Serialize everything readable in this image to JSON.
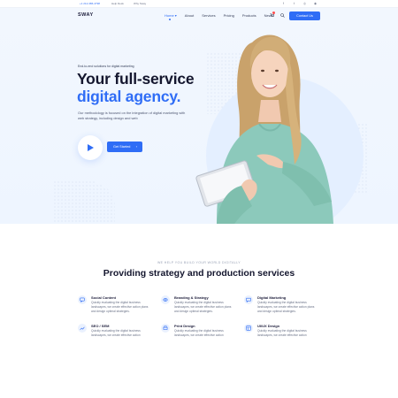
{
  "topbar": {
    "phone": "+1 212-386-4798",
    "help": "Help Desk",
    "why": "Why Sway",
    "socials": [
      "facebook-icon",
      "twitter-icon",
      "instagram-icon",
      "dribbble-icon"
    ]
  },
  "header": {
    "logo": "SWAY",
    "nav": [
      "Home",
      "About",
      "Services",
      "Pricing",
      "Products",
      "News"
    ],
    "contact_label": "Contact Us"
  },
  "hero": {
    "tagline": "End-to-end solutions for digital marketing",
    "headline_line1": "Your full-service",
    "headline_line2": "digital agency.",
    "description": "Our methodology is focused on the integration of digital marketing with web strategy, including design and web",
    "cta_label": "Get Started",
    "cta_arrow": "›"
  },
  "services": {
    "eyebrow": "WE HELP YOU BUILD YOUR WORLD DIGITALLY",
    "title": "Providing strategy and production services",
    "items": [
      {
        "title": "Social Content",
        "desc": "Quickly evaluating the digital business landscapes, we create effective action plans and design optimal strategies.",
        "icon": "chat-icon"
      },
      {
        "title": "Branding & Strategy",
        "desc": "Quickly evaluating the digital business landscapes, we create effective action plans and design optimal strategies.",
        "icon": "eye-icon"
      },
      {
        "title": "Digital Marketing",
        "desc": "Quickly evaluating the digital business landscapes, we create effective action plans and design optimal strategies.",
        "icon": "message-icon"
      },
      {
        "title": "SEO / SEM",
        "desc": "Quickly evaluating the digital business landscapes, we create effective action",
        "icon": "chart-icon"
      },
      {
        "title": "Print Design",
        "desc": "Quickly evaluating the digital business landscapes, we create effective action",
        "icon": "print-icon"
      },
      {
        "title": "UI/UX Design",
        "desc": "Quickly evaluating the digital business landscapes, we create effective action",
        "icon": "layout-icon"
      }
    ]
  },
  "colors": {
    "accent": "#2f6df6",
    "hero_bg": "#f2f7fe",
    "heading": "#14162e"
  }
}
